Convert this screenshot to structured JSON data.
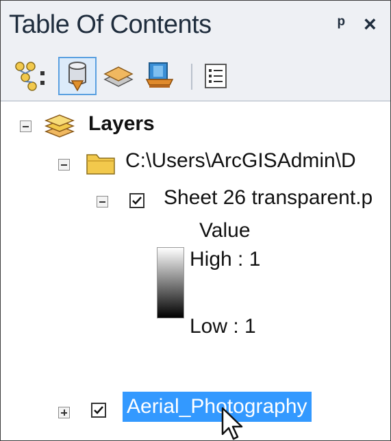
{
  "panel": {
    "title": "Table Of Contents",
    "pin_glyph": "ᵖ",
    "close_glyph": "×"
  },
  "toolbar": {
    "buttons": [
      {
        "name": "list-by-drawing-order",
        "icon": "drawing-order-icon"
      },
      {
        "name": "list-by-source",
        "icon": "source-db-icon",
        "selected": true
      },
      {
        "name": "list-by-visibility",
        "icon": "visibility-layers-icon"
      },
      {
        "name": "list-by-selection",
        "icon": "selection-icon"
      },
      {
        "name": "options",
        "icon": "options-list-icon"
      }
    ]
  },
  "tree": {
    "root_label": "Layers",
    "folder_label": "C:\\Users\\ArcGISAdmin\\D",
    "layer1_label": "Sheet 26 transparent.p",
    "legend": {
      "heading": "Value",
      "high": "High : 1",
      "low": "Low : 1"
    },
    "layer2_label": "Aerial_Photography"
  },
  "colors": {
    "selection": "#3399ff",
    "accent": "#5aa0e0"
  }
}
